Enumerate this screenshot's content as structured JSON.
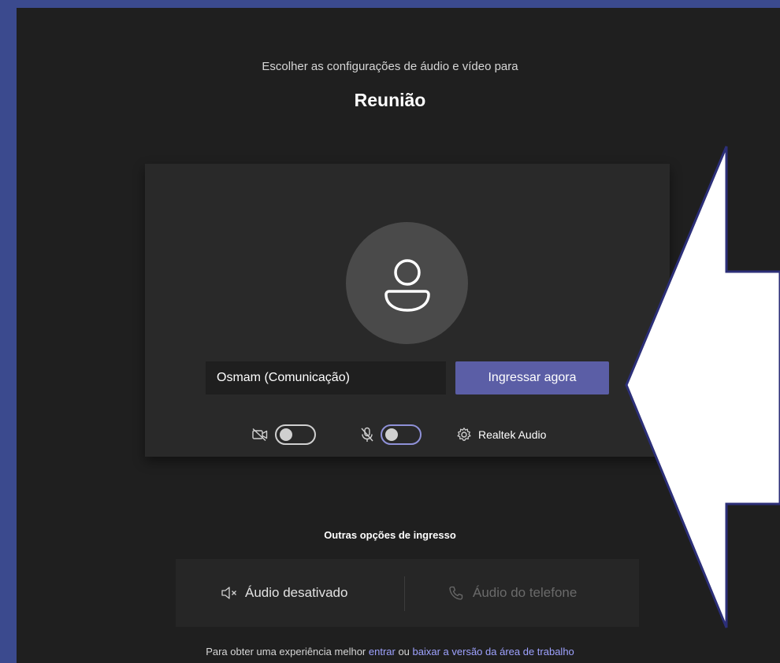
{
  "header": {
    "subtitle": "Escolher as configurações de áudio e vídeo para",
    "title": "Reunião"
  },
  "preview": {
    "name_value": "Osmam (Comunicação)",
    "join_label": "Ingressar agora",
    "camera_on": false,
    "mic_on": false,
    "audio_device": "Realtek Audio"
  },
  "other_options": {
    "title": "Outras opções de ingresso",
    "audio_off_label": "Áudio desativado",
    "phone_audio_label": "Áudio do telefone"
  },
  "footer": {
    "prefix": "Para obter uma experiência melhor ",
    "signin_link": "entrar",
    "middle": " ou ",
    "download_link": "baixar a versão da área de trabalho"
  },
  "colors": {
    "accent": "#5b5ea6",
    "background": "#1f1f1f",
    "card": "#292929",
    "frame": "#3b4a8e",
    "link": "#9ea2ff"
  },
  "icons": [
    "person-icon",
    "camera-off-icon",
    "mic-off-icon",
    "gear-icon",
    "speaker-off-icon",
    "phone-icon",
    "arrow-callout"
  ]
}
